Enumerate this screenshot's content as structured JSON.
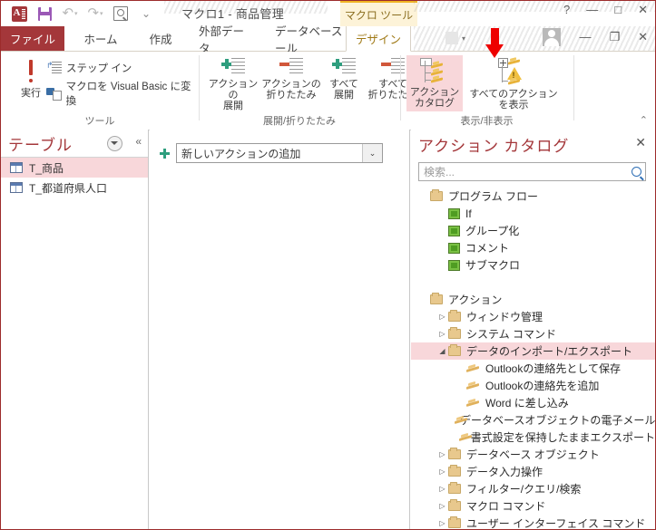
{
  "window": {
    "title": "マクロ1 - 商品管理",
    "contextual_tab": "マクロ ツール",
    "help_icon": "?",
    "minimize_icon": "—",
    "restore_icon": "□",
    "close_icon": "✕",
    "app_minimize_icon": "—",
    "app_restore_icon": "❐",
    "app_close_icon": "✕",
    "accent_red": "#a4373a",
    "selection_pink": "#f8d7da",
    "contextual_gold": "#f0b323"
  },
  "quick_access": {
    "app_icon": "access-logo",
    "items": [
      {
        "name": "save-icon",
        "glyph": ""
      },
      {
        "name": "undo-icon",
        "glyph": "↶"
      },
      {
        "name": "redo-icon",
        "glyph": "↷"
      },
      {
        "name": "print-preview-icon",
        "glyph": ""
      },
      {
        "name": "customize-qat-icon",
        "glyph": "⌄"
      }
    ]
  },
  "ribbon": {
    "file_tab": "ファイル",
    "tabs": [
      {
        "label": "ホーム",
        "active": false
      },
      {
        "label": "作成",
        "active": false
      },
      {
        "label": "外部データ",
        "active": false
      },
      {
        "label": "データベース ツール",
        "active": false
      },
      {
        "label": "デザイン",
        "active": true
      }
    ],
    "groups": [
      {
        "label": "ツール",
        "buttons": [
          {
            "label_line1": "実行",
            "label_line2": "",
            "icon": "run-exclamation-icon"
          },
          {
            "label_line1": "ステップ イン",
            "icon": "step-into-icon"
          },
          {
            "label_line1": "マクロを Visual Basic に変換",
            "icon": "convert-to-vb-icon"
          }
        ]
      },
      {
        "label": "展開/折りたたみ",
        "buttons": [
          {
            "label_line1": "アクションの",
            "label_line2": "展開",
            "icon": "expand-action-icon"
          },
          {
            "label_line1": "アクションの",
            "label_line2": "折りたたみ",
            "icon": "collapse-action-icon"
          },
          {
            "label_line1": "すべて",
            "label_line2": "展開",
            "icon": "expand-all-icon"
          },
          {
            "label_line1": "すべて",
            "label_line2": "折りたたみ",
            "icon": "collapse-all-icon"
          }
        ]
      },
      {
        "label": "表示/非表示",
        "buttons": [
          {
            "label_line1": "アクション",
            "label_line2": "カタログ",
            "icon": "action-catalog-icon",
            "selected": true
          },
          {
            "label_line1": "すべてのアクション",
            "label_line2": "を表示",
            "icon": "show-all-actions-icon",
            "selected": false
          }
        ]
      }
    ],
    "collapse_icon": "⌃"
  },
  "nav_pane": {
    "title": "テーブル",
    "menu_icon": "chevron-down-circle-icon",
    "collapse_icon": "«",
    "items": [
      {
        "label": "T_商品",
        "selected": true
      },
      {
        "label": "T_都道府県人口",
        "selected": false
      }
    ]
  },
  "designer": {
    "add_action_plus": "+",
    "combo_value": "新しいアクションの追加",
    "combo_arrow": "⌄"
  },
  "catalog": {
    "title": "アクション カタログ",
    "close_icon": "✕",
    "search_placeholder": "検索...",
    "search_value": "検索...",
    "search_icon": "magnifier-icon",
    "tree": [
      {
        "label": "プログラム フロー",
        "type": "folder",
        "indent": 0,
        "expander": "",
        "selected": false
      },
      {
        "label": "If",
        "type": "green",
        "indent": 1,
        "expander": "",
        "selected": false
      },
      {
        "label": "グループ化",
        "type": "green",
        "indent": 1,
        "expander": "",
        "selected": false
      },
      {
        "label": "コメント",
        "type": "green",
        "indent": 1,
        "expander": "",
        "selected": false
      },
      {
        "label": "サブマクロ",
        "type": "green",
        "indent": 1,
        "expander": "",
        "selected": false
      },
      {
        "label": "",
        "type": "spacer",
        "indent": 0,
        "expander": "",
        "selected": false
      },
      {
        "label": "アクション",
        "type": "folder",
        "indent": 0,
        "expander": "",
        "selected": false
      },
      {
        "label": "ウィンドウ管理",
        "type": "folder",
        "indent": 1,
        "expander": "▷",
        "selected": false
      },
      {
        "label": "システム コマンド",
        "type": "folder",
        "indent": 1,
        "expander": "▷",
        "selected": false
      },
      {
        "label": "データのインポート/エクスポート",
        "type": "folder",
        "indent": 1,
        "expander": "◢",
        "selected": true
      },
      {
        "label": "Outlookの連絡先として保存",
        "type": "bolt",
        "indent": 2,
        "expander": "",
        "selected": false
      },
      {
        "label": "Outlookの連絡先を追加",
        "type": "bolt",
        "indent": 2,
        "expander": "",
        "selected": false
      },
      {
        "label": "Word に差し込み",
        "type": "bolt",
        "indent": 2,
        "expander": "",
        "selected": false
      },
      {
        "label": "データベースオブジェクトの電子メール送",
        "type": "bolt",
        "indent": 2,
        "expander": "",
        "selected": false
      },
      {
        "label": "書式設定を保持したままエクスポート",
        "type": "bolt",
        "indent": 2,
        "expander": "",
        "selected": false
      },
      {
        "label": "データベース オブジェクト",
        "type": "folder",
        "indent": 1,
        "expander": "▷",
        "selected": false
      },
      {
        "label": "データ入力操作",
        "type": "folder",
        "indent": 1,
        "expander": "▷",
        "selected": false
      },
      {
        "label": "フィルター/クエリ/検索",
        "type": "folder",
        "indent": 1,
        "expander": "▷",
        "selected": false
      },
      {
        "label": "マクロ コマンド",
        "type": "folder",
        "indent": 1,
        "expander": "▷",
        "selected": false
      },
      {
        "label": "ユーザー インターフェイス コマンド",
        "type": "folder",
        "indent": 1,
        "expander": "▷",
        "selected": false
      }
    ]
  },
  "annotation": {
    "arrow_color": "#ee0000",
    "points_to": "action-catalog-ribbon-button"
  }
}
